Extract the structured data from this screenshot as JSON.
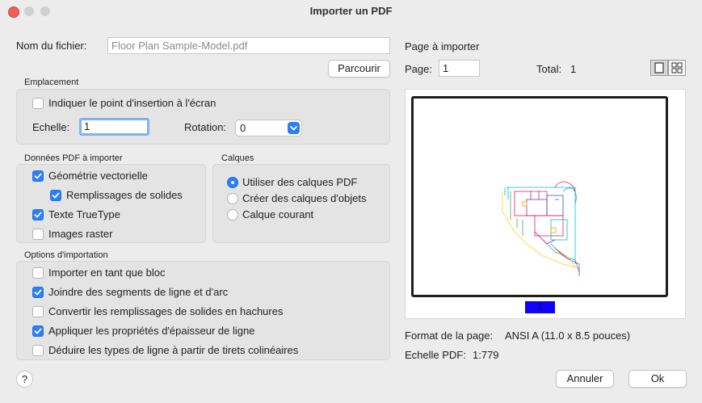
{
  "window": {
    "title": "Importer un PDF"
  },
  "file": {
    "label": "Nom du fichier:",
    "value": "Floor Plan Sample-Model.pdf",
    "browse_label": "Parcourir"
  },
  "placement": {
    "title": "Emplacement",
    "specify_on_screen_label": "Indiquer le point d'insertion à l'écran",
    "specify_on_screen_checked": false,
    "scale_label": "Echelle:",
    "scale_value": "1",
    "rotation_label": "Rotation:",
    "rotation_value": "0"
  },
  "pdf_data": {
    "title": "Données PDF à importer",
    "items": [
      {
        "label": "Géométrie vectorielle",
        "checked": true
      },
      {
        "label": "Remplissages de solides",
        "checked": true
      },
      {
        "label": "Texte TrueType",
        "checked": true
      },
      {
        "label": "Images raster",
        "checked": false
      }
    ]
  },
  "layers": {
    "title": "Calques",
    "options": [
      {
        "label": "Utiliser des calques PDF",
        "selected": true
      },
      {
        "label": "Créer des calques d'objets",
        "selected": false
      },
      {
        "label": "Calque courant",
        "selected": false
      }
    ]
  },
  "import_options": {
    "title": "Options d'importation",
    "items": [
      {
        "label": "Importer en tant que bloc",
        "checked": false
      },
      {
        "label": "Joindre des segments de ligne et d'arc",
        "checked": true
      },
      {
        "label": "Convertir les remplissages de solides en hachures",
        "checked": false
      },
      {
        "label": "Appliquer les propriétés d'épaisseur de ligne",
        "checked": true
      },
      {
        "label": "Déduire les types de ligne à partir de tirets colinéaires",
        "checked": false
      }
    ]
  },
  "page_import": {
    "title": "Page à importer",
    "page_label": "Page:",
    "page_value": "1",
    "total_label": "Total:",
    "total_value": "1",
    "preview_page_tag": "1",
    "format_label": "Format de la page:",
    "format_value": "ANSI A (11.0 x 8.5 pouces)",
    "pdf_scale_label": "Echelle PDF:",
    "pdf_scale_value": "1:779"
  },
  "footer": {
    "help_label": "?",
    "cancel_label": "Annuler",
    "ok_label": "Ok"
  },
  "colors": {
    "accent": "#2a7ef6",
    "page_tag": "#0f00ff"
  }
}
